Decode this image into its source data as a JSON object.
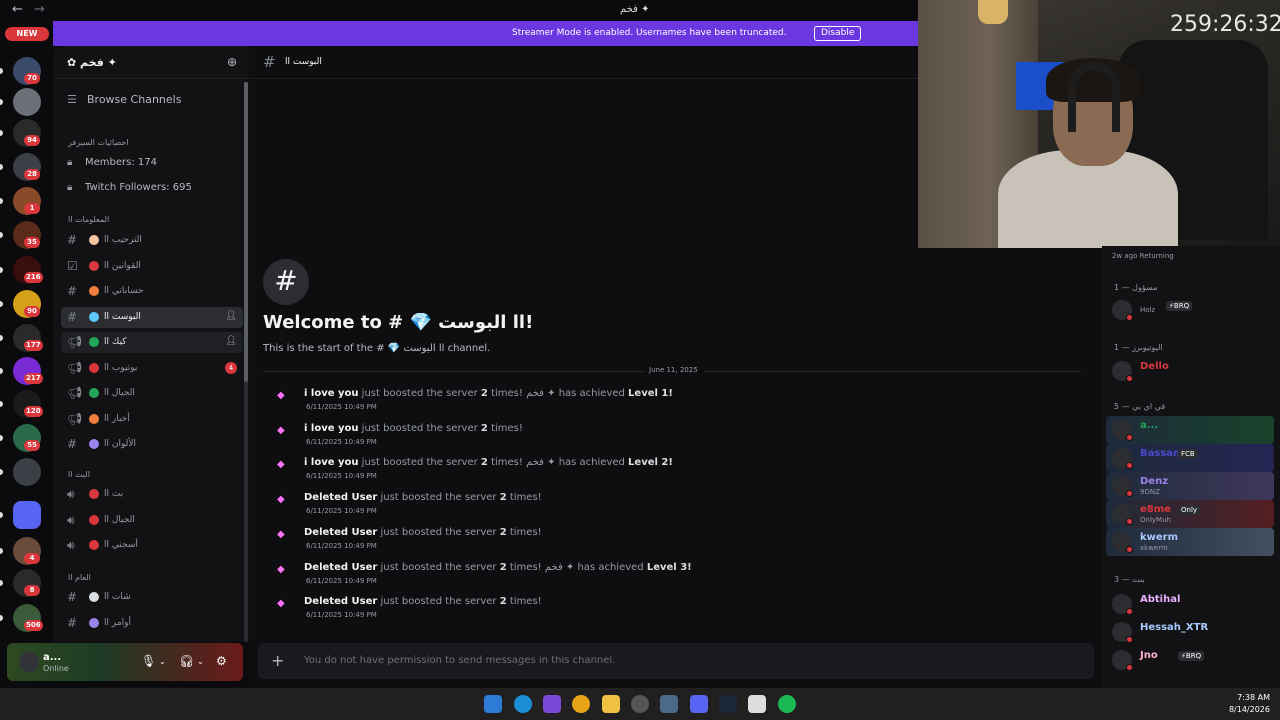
{
  "window": {
    "title": "فخم ✦",
    "back_icon": "arrow-left-icon",
    "forward_icon": "arrow-right-icon"
  },
  "rail": {
    "new_label": "NEW",
    "servers": [
      {
        "badge": "70",
        "color": "#3a4a6a"
      },
      {
        "badge": "",
        "color": "#6a6f78"
      },
      {
        "badge": "94",
        "color": "#2a2a2a"
      },
      {
        "badge": "28",
        "color": "#3b3f46"
      },
      {
        "badge": "1",
        "color": "#8a4a2a"
      },
      {
        "badge": "35",
        "color": "#5a2a1a"
      },
      {
        "badge": "216",
        "color": "#3a0e0e"
      },
      {
        "badge": "90",
        "color": "#d4a017"
      },
      {
        "badge": "177",
        "color": "#2a2a2a"
      },
      {
        "badge": "217",
        "color": "#7a2ad4"
      },
      {
        "badge": "120",
        "color": "#1a1a1a"
      },
      {
        "badge": "55",
        "color": "#2a6a4a"
      },
      {
        "badge": "",
        "color": "#3b3f46"
      },
      {
        "badge": "",
        "color": "#5865f2"
      },
      {
        "badge": "4",
        "color": "#6a4a3a"
      },
      {
        "badge": "8",
        "color": "#2a2a2a"
      },
      {
        "badge": "506",
        "color": "#3a5a3a"
      }
    ]
  },
  "banner": {
    "text": "Streamer Mode is enabled. Usernames have been truncated.",
    "button": "Disable"
  },
  "sidebar": {
    "server_name": "✿ فخم ✦",
    "browse": "Browse Channels",
    "stats_category": "احصائيات السيرفر",
    "members": "Members: 174",
    "followers": "Twitch Followers: 695",
    "cat_info": "المعلومات اا",
    "channels_info": [
      {
        "icon": "hash-icon",
        "emoji": "#f5c6a0",
        "label": "الترحيب اا"
      },
      {
        "icon": "rules-icon",
        "emoji": "#da373c",
        "label": "القوانين اا"
      },
      {
        "icon": "hash-icon",
        "emoji": "#f0803c",
        "label": "حساباتي اا"
      },
      {
        "icon": "hash-icon",
        "emoji": "#5cc8ff",
        "label": "البوست اا",
        "active": true
      },
      {
        "icon": "megaphone-icon",
        "emoji": "#23a55a",
        "label": "كيك اا",
        "hover": true
      },
      {
        "icon": "megaphone-icon",
        "emoji": "#da373c",
        "label": "يوتيوب اا",
        "badge": "4"
      },
      {
        "icon": "megaphone-icon",
        "emoji": "#23a55a",
        "label": "الجيال اا"
      },
      {
        "icon": "megaphone-icon",
        "emoji": "#f0803c",
        "label": "أخبار اا"
      },
      {
        "icon": "hash-icon",
        "emoji": "#9b84ec",
        "label": "الألوان اا"
      }
    ],
    "cat_live": "البث اا",
    "channels_live": [
      {
        "icon": "speaker-icon",
        "emoji": "#da373c",
        "label": "بث اا"
      },
      {
        "icon": "speaker-icon",
        "emoji": "#da373c",
        "label": "الجيال اا"
      },
      {
        "icon": "speaker-icon",
        "emoji": "#da373c",
        "label": "أسجني اا"
      }
    ],
    "cat_general": "العام اا",
    "channels_general": [
      {
        "icon": "hash-icon",
        "emoji": "#dbdee1",
        "label": "شات اا"
      },
      {
        "icon": "hash-icon",
        "emoji": "#9b84ec",
        "label": "أوامر اا"
      }
    ]
  },
  "user": {
    "name": "a...",
    "status": "Online"
  },
  "chat": {
    "channel": "البوست اا",
    "welcome_title": "Welcome to # 💎 اا البوست!",
    "welcome_sub": "This is the start of the # 💎 اا البوست channel.",
    "date": "June 11, 2025",
    "messages": [
      {
        "user": "i love you",
        "text": " just boosted the server ",
        "count": "2",
        "tail": " times! فخم ✦ has achieved ",
        "level": "Level 1!",
        "time": "6/11/2025 10:49 PM"
      },
      {
        "user": "i love you",
        "text": " just boosted the server ",
        "count": "2",
        "tail": " times!",
        "level": "",
        "time": "6/11/2025 10:49 PM"
      },
      {
        "user": "i love you",
        "text": " just boosted the server ",
        "count": "2",
        "tail": " times! فخم ✦ has achieved ",
        "level": "Level 2!",
        "time": "6/11/2025 10:49 PM"
      },
      {
        "user": "Deleted User",
        "text": " just boosted the server ",
        "count": "2",
        "tail": " times!",
        "level": "",
        "time": "6/11/2025 10:49 PM"
      },
      {
        "user": "Deleted User",
        "text": " just boosted the server ",
        "count": "2",
        "tail": " times!",
        "level": "",
        "time": "6/11/2025 10:49 PM"
      },
      {
        "user": "Deleted User",
        "text": " just boosted the server ",
        "count": "2",
        "tail": " times! فخم ✦ has achieved ",
        "level": "Level 3!",
        "time": "6/11/2025 10:49 PM"
      },
      {
        "user": "Deleted User",
        "text": " just boosted the server ",
        "count": "2",
        "tail": " times!",
        "level": "",
        "time": "6/11/2025 10:49 PM"
      }
    ],
    "composer_placeholder": "You do not have permission to send messages in this channel."
  },
  "webcam": {
    "timer": "259:26:32"
  },
  "members": {
    "peek_text": "2w ago   Returning",
    "groups": [
      {
        "title": "مسؤول — 1",
        "people": [
          {
            "name": "",
            "sub": "Holz",
            "tag": "⚡BRQ",
            "color": "#dbdee1"
          }
        ]
      },
      {
        "title": "اليوتيوبرز — 1",
        "people": [
          {
            "name": "Dello",
            "sub": "",
            "tag": "",
            "color": "#da373c"
          }
        ]
      },
      {
        "title": "في اي بي — 5",
        "people": [
          {
            "name": "a...",
            "sub": "",
            "tag": "",
            "color": "#23a55a"
          },
          {
            "name": "Bassam",
            "sub": "",
            "tag": "FCB",
            "color": "#4a4ad0"
          },
          {
            "name": "Denz",
            "sub": "9DNZ",
            "tag": "",
            "color": "#9b84ec"
          },
          {
            "name": "e8me",
            "sub": "OnlyMuh",
            "tag": "Only",
            "color": "#da373c"
          },
          {
            "name": "kwerm",
            "sub": "xkwerm",
            "tag": "",
            "color": "#a8c8ff"
          }
        ]
      },
      {
        "title": "بنت — 3",
        "people": [
          {
            "name": "Abtihal",
            "sub": "",
            "tag": "",
            "color": "#e8b0ff"
          },
          {
            "name": "Hessah_XTR",
            "sub": "",
            "tag": "",
            "color": "#a8c8ff"
          },
          {
            "name": "Jno",
            "sub": "",
            "tag": "⚡BRQ",
            "color": "#ffb0d0"
          }
        ]
      }
    ]
  },
  "taskbar": {
    "time": "7:38 AM",
    "date": "8/14/2026"
  }
}
